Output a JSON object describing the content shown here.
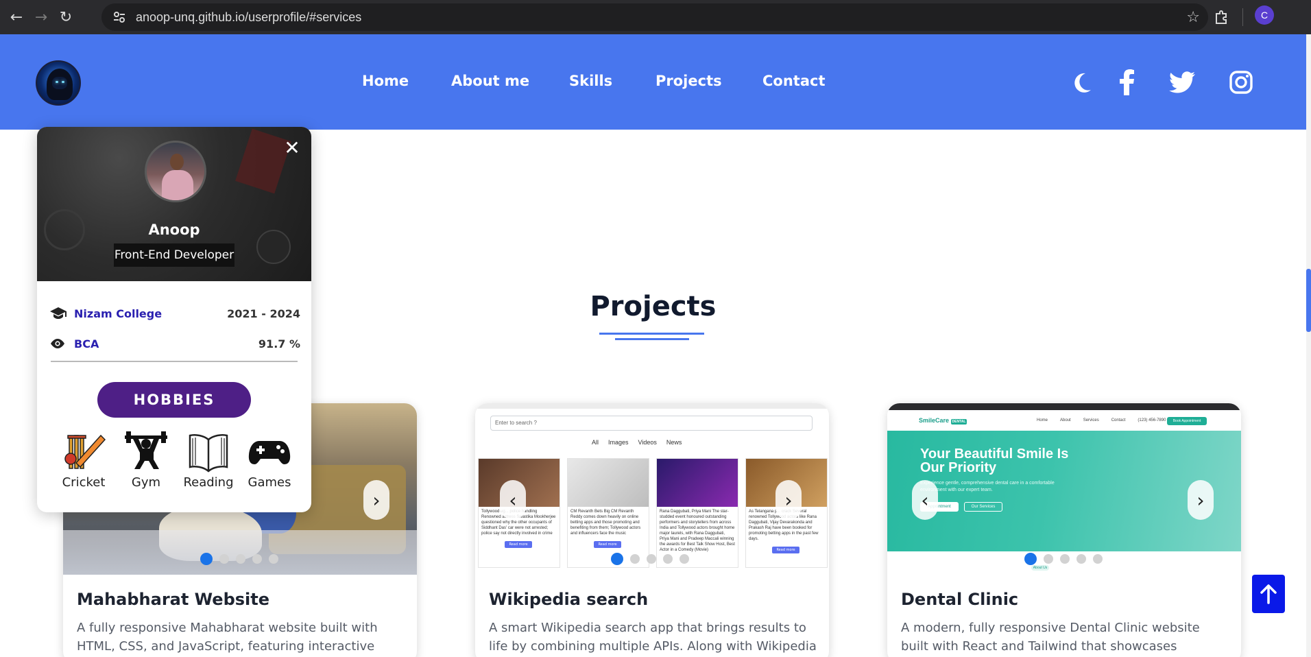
{
  "browser": {
    "url": "anoop-unq.github.io/userprofile/#services",
    "profile_initial": "C",
    "icons": [
      "back-icon",
      "forward-icon",
      "reload-icon",
      "site-settings-icon",
      "bookmark-star-icon",
      "extensions-icon"
    ]
  },
  "header": {
    "nav": [
      "Home",
      "About me",
      "Skills",
      "Projects",
      "Contact"
    ],
    "social_icons": [
      "moon-icon",
      "facebook-icon",
      "twitter-icon",
      "instagram-icon"
    ],
    "accent_color": "#4876ee"
  },
  "section": {
    "title": "Projects"
  },
  "projects": [
    {
      "title": "Mahabharat Website",
      "description": "A fully responsive Mahabharat website built with HTML, CSS, and JavaScript, featuring interactive character cards,",
      "slides": 5,
      "active_slide": 1
    },
    {
      "title": "Wikipedia search",
      "description": "A smart Wikipedia search app that brings results to life by combining multiple APIs. Along with Wikipedia data,",
      "slides": 5,
      "active_slide": 1,
      "screenshot": {
        "search_placeholder": "Enter to search ?",
        "tabs": [
          "All",
          "Images",
          "Videos",
          "News"
        ],
        "cards": [
          {
            "text": "Tollywood ug... police handling Renowned actress Swastika Mookherjee questioned why the other occupants of Siddhant Das' car were not arrested; police say not directly involved in crime",
            "button": "Read more"
          },
          {
            "text": "CM Revanth Bets Big CM Revanth Reddy comes down heavily on online betting apps and those promoting and benefiting from them; Tollywood actors and influencers face the music",
            "button": "Read more"
          },
          {
            "text": "Rana Daggubati, Priya Mani The star-studded event honoured outstanding performers and storytellers from across India and Tollywood actors brought home major laurels, with Rana Daggubati, Priya Mani and Pradeep Maccali winning the awards for Best Talk Show Host, Best Actor in a Comedy (Movie)",
            "button": ""
          },
          {
            "text": "As Telangana p... crack Several renowned Tollywood actors like Rana Daggubati, Vijay Devarakonda and Prakash Raj have been booked for promoting betting apps in the past few days.",
            "button": "Read more"
          }
        ]
      }
    },
    {
      "title": "Dental Clinic",
      "description": "A modern, fully responsive Dental Clinic website built with React and Tailwind that showcases services, enables",
      "slides": 5,
      "active_slide": 1,
      "screenshot": {
        "brand": "SmileCare",
        "brand_badge": "DENTAL",
        "links": [
          "Home",
          "About",
          "Services",
          "Contact",
          "(123) 456-7890"
        ],
        "book_button": "Book Appointment",
        "headline": "Your Beautiful Smile Is Our Priority",
        "subtext": "Experience gentle, comprehensive dental care in a comfortable environment with our expert team.",
        "button_primary": "Appointment",
        "button_secondary": "Our Services",
        "tag": "About Us"
      }
    }
  ],
  "profile_popup": {
    "name": "Anoop",
    "role": "Front-End Developer",
    "education": [
      {
        "icon": "graduation-cap-icon",
        "label": "Nizam College",
        "value": "2021 - 2024"
      },
      {
        "icon": "eye-icon",
        "label": "BCA",
        "value": "91.7 %"
      }
    ],
    "hobbies_label": "HOBBIES",
    "hobbies": [
      {
        "icon": "cricket-icon",
        "label": "Cricket"
      },
      {
        "icon": "gym-icon",
        "label": "Gym"
      },
      {
        "icon": "reading-icon",
        "label": "Reading"
      },
      {
        "icon": "gamepad-icon",
        "label": "Games"
      }
    ]
  }
}
